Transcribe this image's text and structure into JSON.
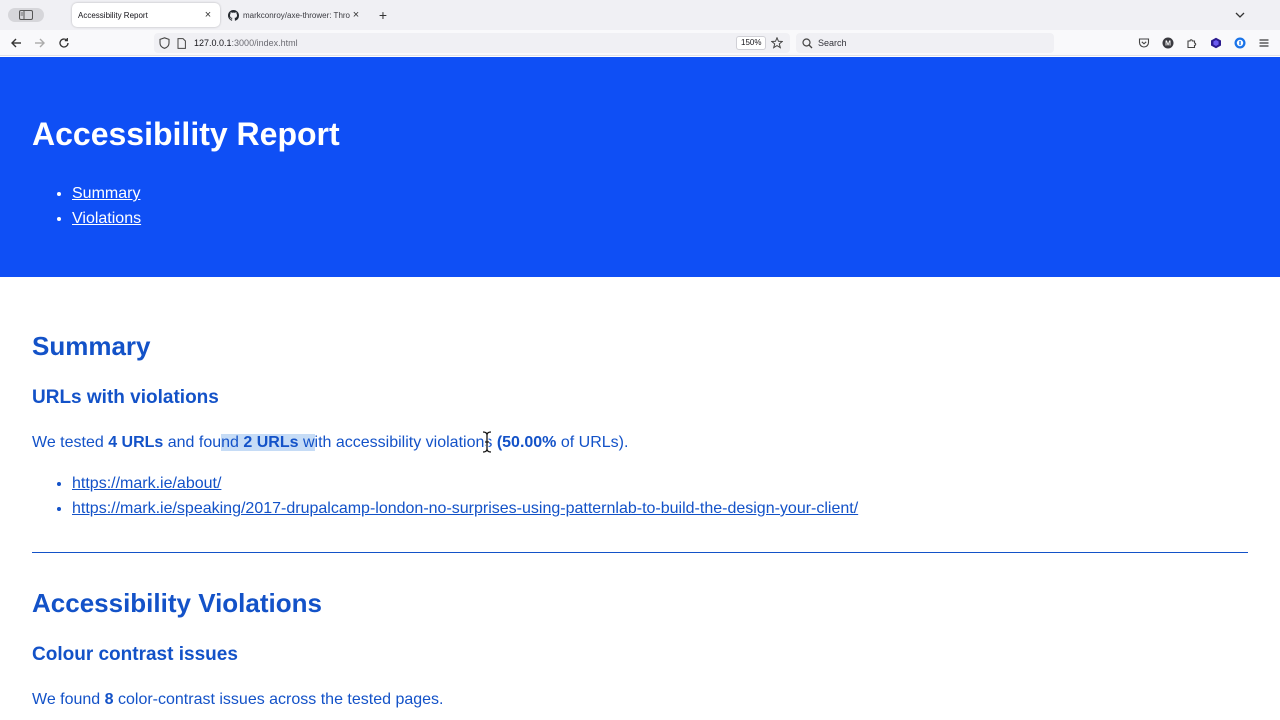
{
  "browser": {
    "tabs": [
      {
        "title": "Accessibility Report",
        "active": true
      },
      {
        "title": "markconroy/axe-thrower: Throw",
        "active": false
      }
    ],
    "url_host": "127.0.0.1",
    "url_path": ":3000/index.html",
    "zoom": "150%",
    "search_placeholder": "Search",
    "colors": {
      "tabbar": "#f0f0f4",
      "navbar": "#f9f9fb"
    }
  },
  "page": {
    "colors": {
      "hero_bg": "#0f4ff5",
      "text": "#1352c8",
      "highlight": "#c6dcf6"
    },
    "title": "Accessibility Report",
    "nav": [
      "Summary",
      "Violations"
    ],
    "summary": {
      "heading": "Summary",
      "subheading": "URLs with violations",
      "sentence": {
        "t1": "We tested ",
        "tested": "4 URLs",
        "t2": " and fou",
        "t3": "nd ",
        "found": "2 URLs",
        "t4": " w",
        "t5": "ith accessibility violations ",
        "percent": "(50.00%",
        "t6": " of URLs)."
      },
      "urls": [
        "https://mark.ie/about/",
        "https://mark.ie/speaking/2017-drupalcamp-london-no-surprises-using-patternlab-to-build-the-design-your-client/"
      ]
    },
    "violations": {
      "heading": "Accessibility Violations",
      "subheading": "Colour contrast issues",
      "sentence": {
        "t1": "We found ",
        "count": "8",
        "t2": " color-contrast issues across the tested pages."
      }
    }
  }
}
